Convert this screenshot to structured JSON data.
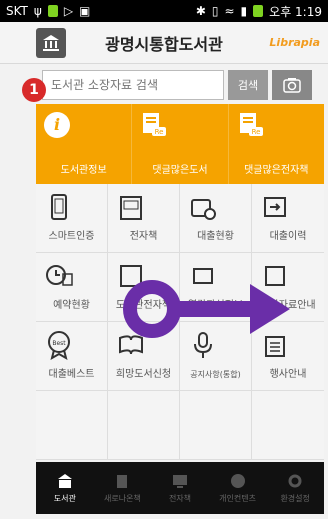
{
  "statusbar": {
    "carrier": "SKT",
    "time": "오후 1:19"
  },
  "header": {
    "title": "광명시통합도서관",
    "brand": "Librapia"
  },
  "search": {
    "placeholder": "도서관 소장자료 검색",
    "button": "검색",
    "camera": "camera-icon"
  },
  "annotation": {
    "badge": "1"
  },
  "quick": [
    {
      "label": "도서관정보",
      "icon": "info-icon"
    },
    {
      "label": "댓글많은도서",
      "icon": "book-re-icon"
    },
    {
      "label": "댓글많은전자책",
      "icon": "ebook-re-icon"
    }
  ],
  "grid": [
    {
      "label": "스마트인증",
      "icon": "smartphone-icon"
    },
    {
      "label": "전자책",
      "icon": "ebook-icon"
    },
    {
      "label": "대출현황",
      "icon": "loan-status-icon"
    },
    {
      "label": "대출이력",
      "icon": "loan-history-icon"
    },
    {
      "label": "예약현황",
      "icon": "clock-icon"
    },
    {
      "label": "도서관전자책",
      "icon": "library-ebook-icon"
    },
    {
      "label": "열람좌석정보",
      "icon": "seat-icon"
    },
    {
      "label": "신착자료안내",
      "icon": "new-arrival-icon"
    },
    {
      "label": "대출베스트",
      "icon": "best-icon"
    },
    {
      "label": "희망도서신청",
      "icon": "book-request-icon"
    },
    {
      "label": "공지사항(통합)",
      "icon": "notice-icon"
    },
    {
      "label": "행사안내",
      "icon": "event-icon"
    }
  ],
  "tabs": [
    {
      "label": "도서관",
      "icon": "home-icon",
      "active": true
    },
    {
      "label": "새로나온책",
      "icon": "newbook-icon",
      "active": false
    },
    {
      "label": "전자책",
      "icon": "ebook-tab-icon",
      "active": false
    },
    {
      "label": "개인컨텐츠",
      "icon": "personal-icon",
      "active": false
    },
    {
      "label": "환경설정",
      "icon": "settings-icon",
      "active": false
    }
  ],
  "colors": {
    "orange": "#f5a300",
    "arrow": "#6a2ea8"
  }
}
